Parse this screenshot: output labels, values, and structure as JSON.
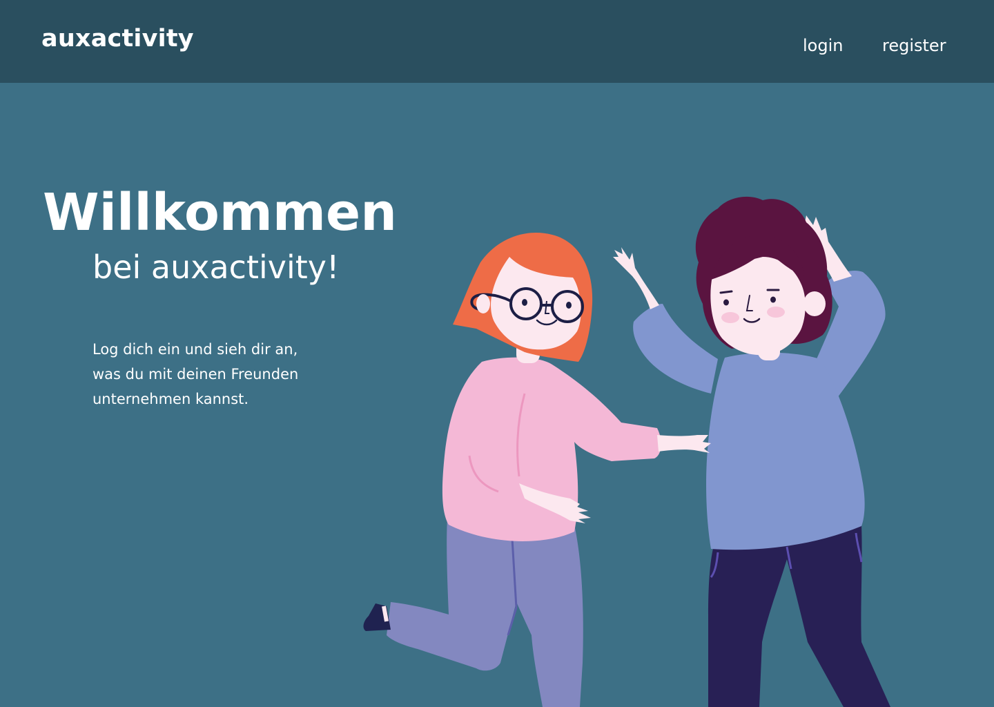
{
  "header": {
    "brand": "auxactivity",
    "nav": {
      "login_label": "login",
      "register_label": "register"
    }
  },
  "hero": {
    "title": "Willkommen",
    "subtitle": "bei auxactivity!",
    "description_lines": [
      "Log dich ein und sieh dir an,",
      "was du mit deinen Freunden",
      "unternehmen kannst."
    ]
  },
  "colors": {
    "background": "#3d7086",
    "header": "#2a4f5f",
    "text": "#ffffff",
    "sweater_pink": "#f4b8d6",
    "sweater_blue": "#8196cf",
    "hair_orange": "#ee6c47",
    "hair_purple": "#5a1440",
    "pants_lilac": "#8388c0",
    "pants_navy": "#282055"
  },
  "illustration": {
    "name": "two-friends-high-five"
  }
}
